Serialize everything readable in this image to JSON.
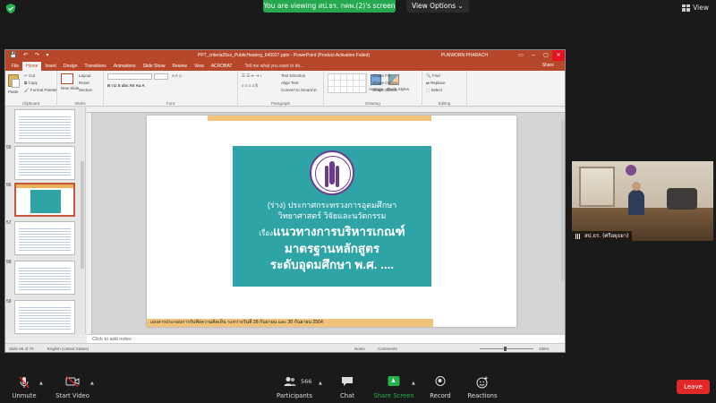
{
  "zoom": {
    "banner": "You are viewing สป.ธร. กคพ.(2)'s screen",
    "view_options": "View Options ⌄",
    "view": "View"
  },
  "ppt": {
    "title": "PPT_criteria25xx_PublicHearing_640927.pptx - PowerPoint (Product Activation Failed)",
    "user": "PUNWORN PHARACH",
    "tabs": [
      "File",
      "Home",
      "Insert",
      "Design",
      "Transitions",
      "Animations",
      "Slide Show",
      "Review",
      "View",
      "ACROBAT"
    ],
    "tell_me": "Tell me what you want to do...",
    "share": "Share",
    "ribbon": {
      "paste": "Paste",
      "cut": "Cut",
      "copy": "Copy",
      "format_painter": "Format Painter",
      "clipboard": "Clipboard",
      "new_slide": "New Slide",
      "layout": "Layout",
      "reset": "Reset",
      "section": "Section",
      "slides": "Slides",
      "font": "Font",
      "text_direction": "Text Direction",
      "align_text": "Align Text",
      "convert_smartart": "Convert to SmartArt",
      "paragraph": "Paragraph",
      "arrange": "Arrange",
      "quick_styles": "Quick Styles",
      "shape_fill": "Shape Fill",
      "shape_outline": "Shape Outline",
      "shape_effects": "Shape Effects",
      "drawing": "Drawing",
      "find": "Find",
      "replace": "Replace",
      "select": "Select",
      "editing": "Editing"
    },
    "thumb_numbers": [
      "55",
      "56",
      "57",
      "58",
      "59"
    ],
    "slide": {
      "line1": "(ร่าง) ประกาศกระทรวงการอุดมศึกษา",
      "line2": "วิทยาศาสตร์ วิจัยและนวัตกรรม",
      "line3_prefix": "เรื่อง",
      "line3": "แนวทางการบริหารเกณฑ์",
      "line4": "มาตรฐานหลักสูตร",
      "line5": "ระดับอุดมศึกษา พ.ศ. ....",
      "footer": "เอกสารประกอบการรับฟังความคิดเห็น ระหว่างวันที่ 28 กันยายน และ 30 กันยายน 2564"
    },
    "notes_placeholder": "Click to add notes",
    "status": {
      "slide_count": "Slide 56 of 70",
      "language": "English (United States)",
      "notes": "Notes",
      "comments": "Comments",
      "zoom": "106%"
    }
  },
  "video": {
    "name": "สป.ธร. (ศรีอยุธยา)"
  },
  "toolbar": {
    "unmute": "Unmute",
    "start_video": "Start Video",
    "participants": "Participants",
    "participants_count": "566",
    "chat": "Chat",
    "share_screen": "Share Screen",
    "record": "Record",
    "reactions": "Reactions",
    "leave": "Leave"
  }
}
